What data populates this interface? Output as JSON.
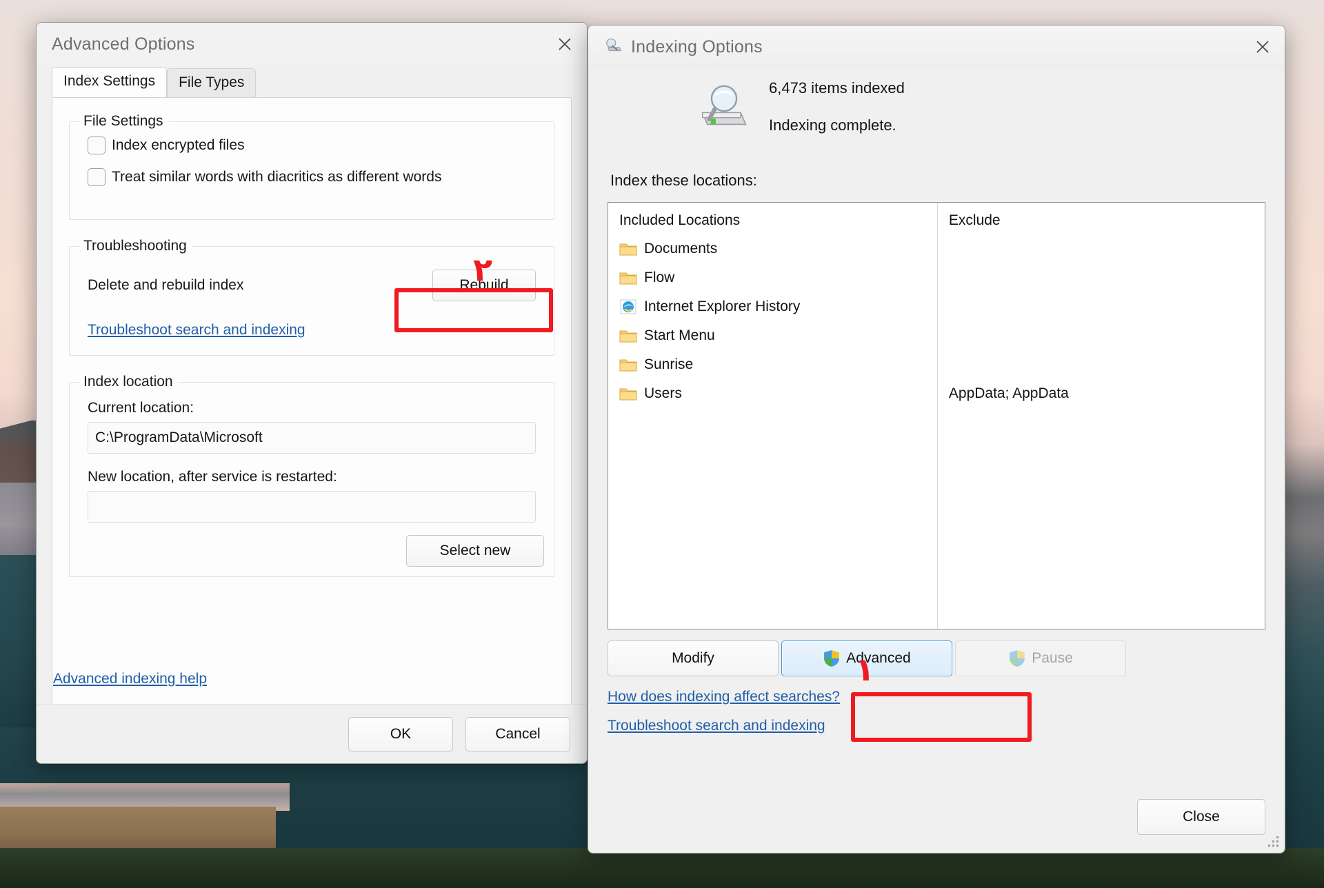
{
  "advanced_options": {
    "title": "Advanced Options",
    "close_label": "close-icon",
    "tabs": [
      {
        "label": "Index Settings",
        "active": true
      },
      {
        "label": "File Types",
        "active": false
      }
    ],
    "file_settings": {
      "legend": "File Settings",
      "checkboxes": [
        {
          "label": "Index encrypted files",
          "checked": false
        },
        {
          "label": "Treat similar words with diacritics as different words",
          "checked": false
        }
      ]
    },
    "troubleshooting": {
      "legend": "Troubleshooting",
      "row_label": "Delete and rebuild index",
      "rebuild_button": "Rebuild",
      "link": "Troubleshoot search and indexing"
    },
    "index_location": {
      "legend": "Index location",
      "current_label": "Current location:",
      "current_value": "C:\\ProgramData\\Microsoft",
      "new_label": "New location, after service is restarted:",
      "new_value": "",
      "new_placeholder": "",
      "select_new_button": "Select new"
    },
    "help_link": "Advanced indexing help",
    "footer": {
      "ok": "OK",
      "cancel": "Cancel"
    }
  },
  "indexing_options": {
    "title": "Indexing Options",
    "title_icon": "indexing-options-icon",
    "close_label": "close-icon",
    "status": {
      "items_indexed": "6,473 items indexed",
      "state": "Indexing complete.",
      "icon": "search-drive-icon"
    },
    "locations_label": "Index these locations:",
    "list": {
      "included_header": "Included Locations",
      "exclude_header": "Exclude",
      "rows": [
        {
          "icon": "folder-icon",
          "name": "Documents",
          "exclude": ""
        },
        {
          "icon": "folder-icon",
          "name": "Flow",
          "exclude": ""
        },
        {
          "icon": "internet-explorer-icon",
          "name": "Internet Explorer History",
          "exclude": ""
        },
        {
          "icon": "folder-icon",
          "name": "Start Menu",
          "exclude": ""
        },
        {
          "icon": "folder-icon",
          "name": "Sunrise",
          "exclude": ""
        },
        {
          "icon": "folder-icon",
          "name": "Users",
          "exclude": "AppData; AppData"
        }
      ]
    },
    "buttons": {
      "modify": "Modify",
      "advanced": "Advanced",
      "advanced_focused": true,
      "pause": "Pause",
      "pause_disabled": true,
      "shield_icon": "uac-shield-icon"
    },
    "links": [
      "How does indexing affect searches?",
      "Troubleshoot search and indexing"
    ],
    "close_button": "Close"
  },
  "annotations": {
    "marker_advanced": "۱",
    "marker_rebuild": "۲",
    "highlight_color": "#ef1b20"
  }
}
